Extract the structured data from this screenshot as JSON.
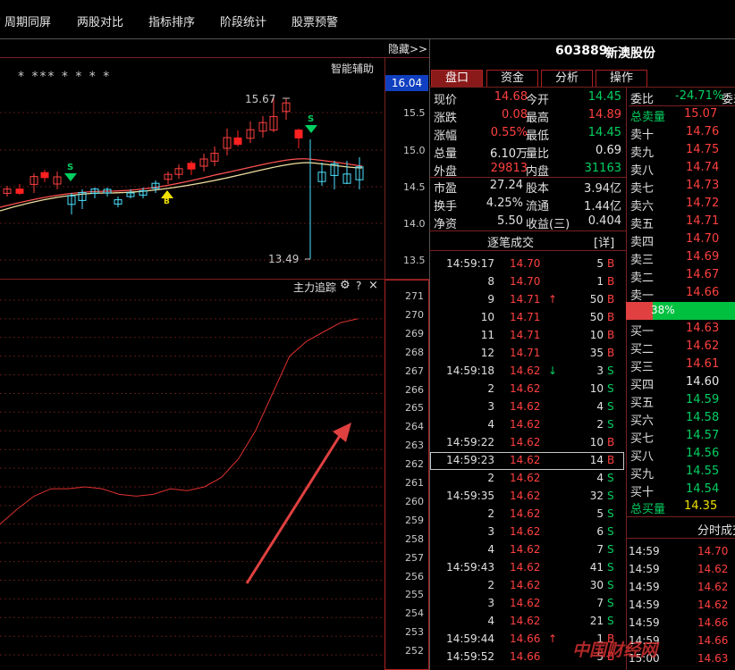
{
  "menu": [
    {
      "label": "周期同屏",
      "icon": "chevron-right-icon"
    },
    {
      "label": "两股对比"
    },
    {
      "label": "指标排序"
    },
    {
      "label": "阶段统计"
    },
    {
      "label": "股票预警"
    }
  ],
  "chart": {
    "hide_label": "隐藏>>",
    "smart_assist": "智能辅助",
    "stars": "* ***     *   *   *        *",
    "high_label": "15.67",
    "low_label": "13.49",
    "current_price_tag": "16.04",
    "price_ticks": [
      "15.5",
      "15.0",
      "14.5",
      "14.0",
      "13.5"
    ],
    "signal_s": "S",
    "signal_b": "B"
  },
  "indicator": {
    "title": "主力追踪",
    "gear_icon": "gear-icon",
    "help": "?",
    "close": "×",
    "ticks": [
      "271",
      "270",
      "269",
      "268",
      "267",
      "266",
      "265",
      "264",
      "263",
      "262",
      "261",
      "260",
      "259",
      "258",
      "257",
      "256",
      "255",
      "254",
      "253",
      "252"
    ]
  },
  "chart_data": {
    "type": "line",
    "title": "主力追踪",
    "ylim": [
      251.5,
      271.5
    ],
    "grid": true,
    "series": [
      {
        "values": [
          259,
          259.8,
          260.5,
          260.9,
          260.9,
          261,
          260.9,
          260.6,
          260.5,
          260.6,
          260.9,
          260.8,
          261,
          261.5,
          262.5,
          264,
          266,
          268,
          268.8,
          269.3,
          269.8,
          270
        ]
      }
    ]
  },
  "quote": {
    "code": "603889",
    "name": "新澳股份",
    "tabs": [
      "盘口",
      "资金",
      "分析",
      "操作"
    ],
    "rows": [
      {
        "l1": "现价",
        "v1": "14.68",
        "c1": "red",
        "l2": "今开",
        "v2": "14.45",
        "c2": "green"
      },
      {
        "l1": "涨跌",
        "v1": "0.08",
        "c1": "red",
        "l2": "最高",
        "v2": "14.89",
        "c2": "red"
      },
      {
        "l1": "涨幅",
        "v1": "0.55%",
        "c1": "red",
        "l2": "最低",
        "v2": "14.45",
        "c2": "green"
      },
      {
        "l1": "总量",
        "v1": "6.10万",
        "c1": "white",
        "l2": "量比",
        "v2": "0.69",
        "c2": "white"
      },
      {
        "l1": "外盘",
        "v1": "29813",
        "c1": "red",
        "l2": "内盘",
        "v2": "31163",
        "c2": "green"
      }
    ],
    "rows2": [
      {
        "l1": "市盈",
        "v1": "27.24",
        "l2": "股本",
        "v2": "3.94亿"
      },
      {
        "l1": "换手",
        "v1": "4.25%",
        "l2": "流通",
        "v2": "1.44亿"
      },
      {
        "l1": "净资",
        "v1": "5.50",
        "l2": "收益(三)",
        "v2": "0.404"
      }
    ]
  },
  "ticks_panel": {
    "title": "逐笔成交",
    "detail": "[详]",
    "rows": [
      {
        "time": "14:59:17",
        "price": "14.70",
        "vol": "5",
        "side": "B",
        "arrow": ""
      },
      {
        "time": "8",
        "price": "14.70",
        "vol": "1",
        "side": "B",
        "arrow": ""
      },
      {
        "time": "9",
        "price": "14.71",
        "vol": "50",
        "side": "B",
        "arrow": "↑"
      },
      {
        "time": "10",
        "price": "14.71",
        "vol": "50",
        "side": "B",
        "arrow": ""
      },
      {
        "time": "11",
        "price": "14.71",
        "vol": "10",
        "side": "B",
        "arrow": ""
      },
      {
        "time": "12",
        "price": "14.71",
        "vol": "35",
        "side": "B",
        "arrow": ""
      },
      {
        "time": "14:59:18",
        "price": "14.62",
        "vol": "3",
        "side": "S",
        "arrow": "↓"
      },
      {
        "time": "2",
        "price": "14.62",
        "vol": "10",
        "side": "S",
        "arrow": ""
      },
      {
        "time": "3",
        "price": "14.62",
        "vol": "4",
        "side": "S",
        "arrow": ""
      },
      {
        "time": "4",
        "price": "14.62",
        "vol": "2",
        "side": "S",
        "arrow": ""
      },
      {
        "time": "14:59:22",
        "price": "14.62",
        "vol": "10",
        "side": "B",
        "arrow": ""
      },
      {
        "time": "14:59:23",
        "price": "14.62",
        "vol": "14",
        "side": "B",
        "arrow": ""
      },
      {
        "time": "2",
        "price": "14.62",
        "vol": "4",
        "side": "S",
        "arrow": ""
      },
      {
        "time": "14:59:35",
        "price": "14.62",
        "vol": "32",
        "side": "S",
        "arrow": ""
      },
      {
        "time": "2",
        "price": "14.62",
        "vol": "5",
        "side": "S",
        "arrow": ""
      },
      {
        "time": "3",
        "price": "14.62",
        "vol": "6",
        "side": "S",
        "arrow": ""
      },
      {
        "time": "4",
        "price": "14.62",
        "vol": "7",
        "side": "S",
        "arrow": ""
      },
      {
        "time": "14:59:43",
        "price": "14.62",
        "vol": "41",
        "side": "S",
        "arrow": ""
      },
      {
        "time": "2",
        "price": "14.62",
        "vol": "30",
        "side": "S",
        "arrow": ""
      },
      {
        "time": "3",
        "price": "14.62",
        "vol": "7",
        "side": "S",
        "arrow": ""
      },
      {
        "time": "4",
        "price": "14.62",
        "vol": "21",
        "side": "S",
        "arrow": ""
      },
      {
        "time": "14:59:44",
        "price": "14.66",
        "vol": "1",
        "side": "B",
        "arrow": "↑"
      },
      {
        "time": "14:59:52",
        "price": "14.66",
        "vol": "5",
        "side": "B",
        "arrow": ""
      }
    ]
  },
  "orderbook": {
    "wei_bi_label": "委比",
    "wei_bi_value": "-24.71%",
    "wei_cha_label": "委差",
    "total_sell_label": "总卖量",
    "total_sell_value": "15.07",
    "sells": [
      {
        "label": "卖十",
        "price": "14.76"
      },
      {
        "label": "卖九",
        "price": "14.75"
      },
      {
        "label": "卖八",
        "price": "14.74"
      },
      {
        "label": "卖七",
        "price": "14.73"
      },
      {
        "label": "卖六",
        "price": "14.72"
      },
      {
        "label": "卖五",
        "price": "14.71"
      },
      {
        "label": "卖四",
        "price": "14.70"
      },
      {
        "label": "卖三",
        "price": "14.69"
      },
      {
        "label": "卖二",
        "price": "14.67"
      },
      {
        "label": "卖一",
        "price": "14.66"
      }
    ],
    "ratio_label": "38%",
    "ratio_fraction": 0.38,
    "buys": [
      {
        "label": "买一",
        "price": "14.63",
        "c": "red"
      },
      {
        "label": "买二",
        "price": "14.62",
        "c": "red"
      },
      {
        "label": "买三",
        "price": "14.61",
        "c": "red"
      },
      {
        "label": "买四",
        "price": "14.60",
        "c": "white"
      },
      {
        "label": "买五",
        "price": "14.59",
        "c": "green"
      },
      {
        "label": "买六",
        "price": "14.58",
        "c": "green"
      },
      {
        "label": "买七",
        "price": "14.57",
        "c": "green"
      },
      {
        "label": "买八",
        "price": "14.56",
        "c": "green"
      },
      {
        "label": "买九",
        "price": "14.55",
        "c": "green"
      },
      {
        "label": "买十",
        "price": "14.54",
        "c": "green"
      }
    ],
    "total_buy_label": "总买量",
    "total_buy_value": "14.35",
    "minute_title": "分时成交",
    "minute_rows": [
      {
        "time": "14:59",
        "price": "14.70"
      },
      {
        "time": "14:59",
        "price": "14.62"
      },
      {
        "time": "14:59",
        "price": "14.62"
      },
      {
        "time": "14:59",
        "price": "14.62"
      },
      {
        "time": "14:59",
        "price": "14.66"
      },
      {
        "time": "14:59",
        "price": "14.66"
      },
      {
        "time": "15:00",
        "price": "14.63"
      }
    ]
  },
  "watermark": "中国财经网"
}
